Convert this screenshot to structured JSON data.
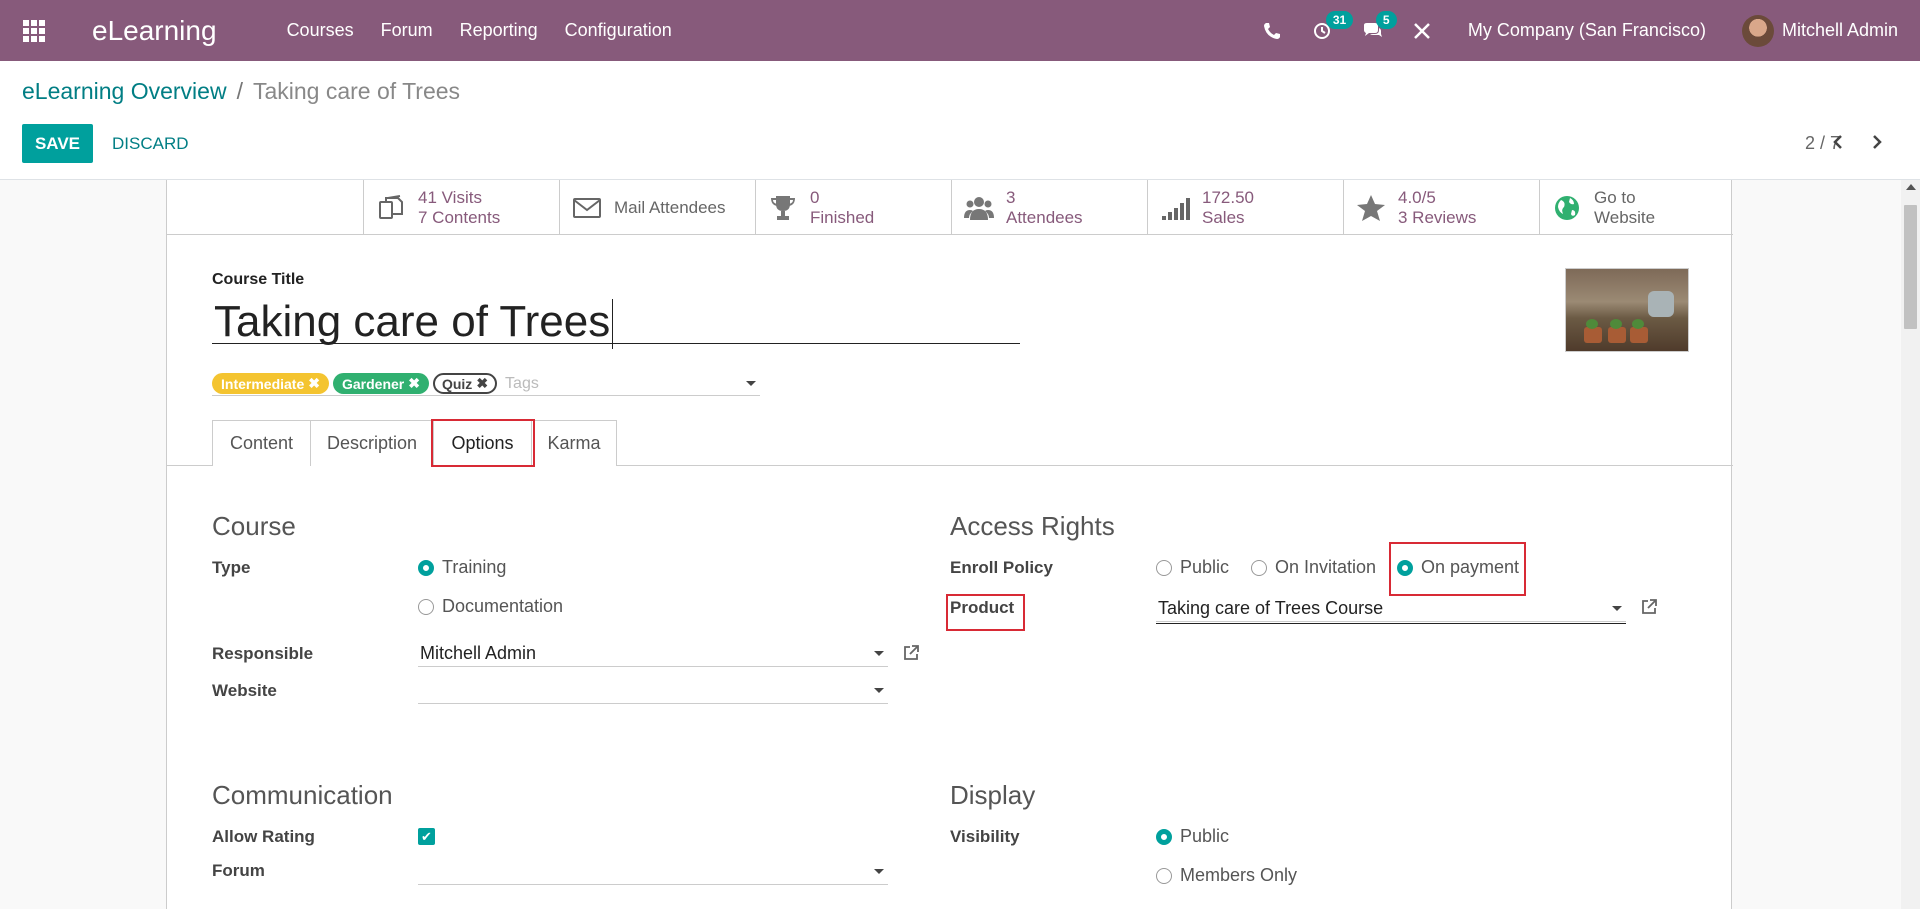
{
  "navbar": {
    "brand": "eLearning",
    "menu": [
      "Courses",
      "Forum",
      "Reporting",
      "Configuration"
    ],
    "activity_count": "31",
    "message_count": "5",
    "company": "My Company (San Francisco)",
    "user": "Mitchell Admin",
    "bg_color": "#875a7b"
  },
  "breadcrumb": {
    "parent": "eLearning Overview",
    "separator": "/",
    "current": "Taking care of Trees"
  },
  "buttons": {
    "save": "SAVE",
    "discard": "DISCARD"
  },
  "pager": {
    "value": "2 / 7"
  },
  "stats": [
    {
      "line1": "41 Visits",
      "line2": "7 Contents",
      "icon": "contents-icon"
    },
    {
      "line1": "Mail Attendees",
      "line2": "",
      "icon": "mail-icon"
    },
    {
      "line1": "0",
      "line2": "Finished",
      "icon": "trophy-icon"
    },
    {
      "line1": "3",
      "line2": "Attendees",
      "icon": "users-icon"
    },
    {
      "line1": "172.50",
      "line2": "Sales",
      "icon": "signal-icon"
    },
    {
      "line1": "4.0/5",
      "line2": "3 Reviews",
      "icon": "star-icon"
    },
    {
      "line1": "Go to",
      "line2": "Website",
      "icon": "globe-icon"
    }
  ],
  "form": {
    "course_title_label": "Course Title",
    "course_title": "Taking care of Trees",
    "tags": [
      {
        "name": "Intermediate",
        "color": "#f4c430"
      },
      {
        "name": "Gardener",
        "color": "#30b070"
      },
      {
        "name": "Quiz",
        "color": "#ffffff"
      }
    ],
    "tags_placeholder": "Tags"
  },
  "tabs": [
    "Content",
    "Description",
    "Options",
    "Karma"
  ],
  "active_tab": "Options",
  "course_section": {
    "title": "Course",
    "type_label": "Type",
    "type_options": [
      "Training",
      "Documentation"
    ],
    "type_selected": "Training",
    "responsible_label": "Responsible",
    "responsible": "Mitchell Admin",
    "website_label": "Website",
    "website": ""
  },
  "access_section": {
    "title": "Access Rights",
    "enroll_label": "Enroll Policy",
    "enroll_options": [
      "Public",
      "On Invitation",
      "On payment"
    ],
    "enroll_selected": "On payment",
    "product_label": "Product",
    "product": "Taking care of Trees Course"
  },
  "communication_section": {
    "title": "Communication",
    "allow_rating_label": "Allow Rating",
    "allow_rating": true,
    "forum_label": "Forum",
    "forum": ""
  },
  "display_section": {
    "title": "Display",
    "visibility_label": "Visibility",
    "visibility_options": [
      "Public",
      "Members Only"
    ],
    "visibility_selected": "Public"
  },
  "accent_color": "#00a09d",
  "highlight_color": "#d82a35"
}
